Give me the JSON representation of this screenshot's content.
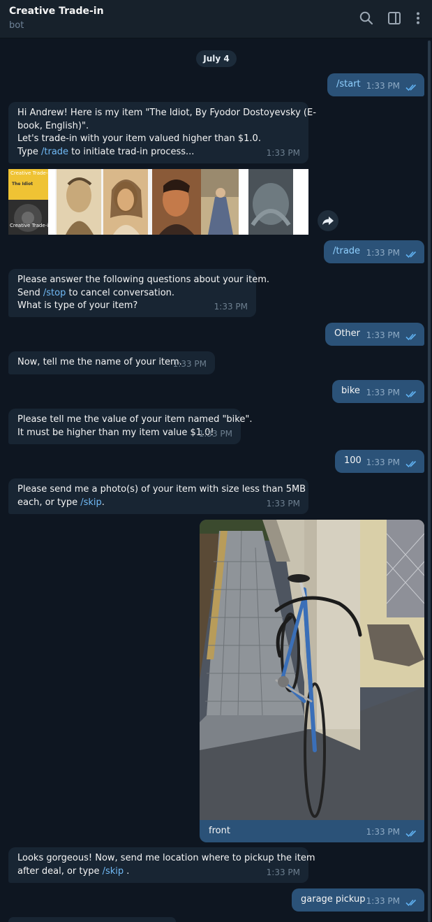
{
  "header": {
    "title": "Creative Trade-in",
    "subtitle": "bot",
    "icons": [
      "search-icon",
      "sidebar-toggle-icon",
      "more-vert-icon"
    ]
  },
  "date_separator": "July 4",
  "messages": {
    "m1": {
      "text": "/start",
      "time": "1:33 PM"
    },
    "m2": {
      "line1": "Hi Andrew! Here is my item \"The Idiot, By Fyodor Dostoyevsky (E-",
      "line2": "book, English)\".",
      "line3": "Let's trade-in with your item valued higher than $1.0.",
      "line4_pre": "Type ",
      "line4_cmd": "/trade",
      "line4_post": " to initiate trad-in process...",
      "time": "1:33 PM"
    },
    "m2_image": {
      "cover_label_top": "Creative Trade-in",
      "cover_title": "The Idiot",
      "cover_label_bottom": "Creative Trade-in"
    },
    "m3": {
      "text": "/trade",
      "time": "1:33 PM"
    },
    "m4": {
      "line1": "Please answer the following questions about your item.",
      "line2_pre": "Send ",
      "line2_cmd": "/stop",
      "line2_post": " to cancel conversation.",
      "line3": "What is type of your item?",
      "time": "1:33 PM"
    },
    "m5": {
      "text": "Other",
      "time": "1:33 PM"
    },
    "m6": {
      "text": "Now, tell me the name of your item.",
      "time": "1:33 PM"
    },
    "m7": {
      "text": "bike",
      "time": "1:33 PM"
    },
    "m8": {
      "line1": "Please tell me the value of your item named \"bike\".",
      "line2": "It must be higher than my item value $1.0!",
      "time": "1:33 PM"
    },
    "m9": {
      "text": "100",
      "time": "1:33 PM"
    },
    "m10": {
      "line1": "Please send me a photo(s) of your item with size less than 5MB",
      "line2_pre": "each, or type ",
      "line2_cmd": "/skip",
      "line2_post": ".",
      "time": "1:33 PM"
    },
    "m11": {
      "caption": "front",
      "time": "1:33 PM"
    },
    "m12": {
      "line1": "Looks gorgeous! Now, send me location where to pickup the item",
      "line2_pre": "after deal, or type ",
      "line2_cmd": "/skip",
      "line2_post": " .",
      "time": "1:33 PM"
    },
    "m13": {
      "text": "garage pickup",
      "time": "1:33 PM"
    }
  },
  "colors": {
    "background": "#0e1621",
    "header": "#17212b",
    "incoming_bubble": "#182533",
    "outgoing_bubble": "#2b5278",
    "command_link": "#71baf6",
    "read_ticks": "#5fb0f0"
  }
}
